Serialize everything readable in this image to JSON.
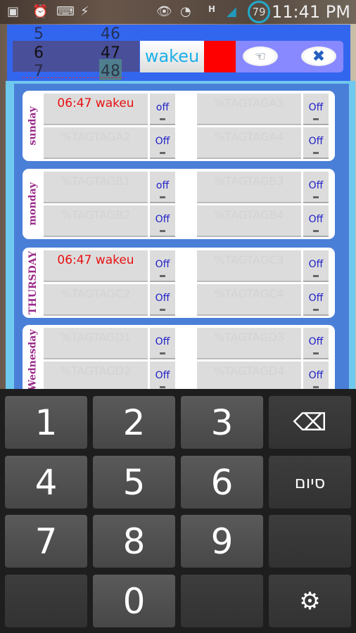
{
  "status_bar": {
    "time": "11:41 PM",
    "battery": "79",
    "network": "H",
    "icons": [
      "gallery-icon",
      "alarm-icon",
      "keyboard-icon",
      "flash-icon",
      "eye-icon",
      "sync-icon",
      "signal-icon",
      "battery-icon"
    ]
  },
  "picker": {
    "hours": [
      "5",
      "6",
      "7"
    ],
    "minutes": [
      "46",
      "47",
      "48"
    ]
  },
  "alarm_name": "wakeu",
  "alarm_color": "#ff0000",
  "buttons": {
    "save_icon": "hand-save-icon",
    "cancel_icon": "close-x-icon"
  },
  "days": [
    {
      "name": "sunday",
      "cells": [
        {
          "text": "06:47  wakeu",
          "active": true,
          "toggle": "off"
        },
        {
          "text": "%TAGTAGA2",
          "toggle": "Off"
        },
        {
          "text": "%TAGTAGA3",
          "toggle": "Off"
        },
        {
          "text": "%TAGTAGA4",
          "toggle": "Off"
        }
      ]
    },
    {
      "name": "monday",
      "cells": [
        {
          "text": "%TAGTAGB1",
          "toggle": "off"
        },
        {
          "text": "%TAGTAGB2",
          "toggle": "Off"
        },
        {
          "text": "%TAGTAGB3",
          "toggle": "Off"
        },
        {
          "text": "%TAGTAGB4",
          "toggle": "Off"
        }
      ]
    },
    {
      "name": "THURSDAY",
      "cells": [
        {
          "text": "06:47  wakeu",
          "active": true,
          "toggle": "Off"
        },
        {
          "text": "%TAGTAGC2",
          "toggle": "Off"
        },
        {
          "text": "%TAGTAGC3",
          "toggle": "Off"
        },
        {
          "text": "%TAGTAGC4",
          "toggle": "Off"
        }
      ]
    },
    {
      "name": "Wednesday",
      "cells": [
        {
          "text": "%TAGTAGD1",
          "toggle": "Off"
        },
        {
          "text": "%TAGTAGD2",
          "toggle": "Off"
        },
        {
          "text": "%TAGTAGD3",
          "toggle": "Off"
        },
        {
          "text": "%TAGTAGD4",
          "toggle": "Off"
        }
      ]
    }
  ],
  "keyboard": {
    "keys": [
      "1",
      "2",
      "3",
      "⌫",
      "4",
      "5",
      "6",
      "סיום",
      "7",
      "8",
      "9",
      "",
      "",
      "0",
      "",
      "⚙"
    ]
  }
}
